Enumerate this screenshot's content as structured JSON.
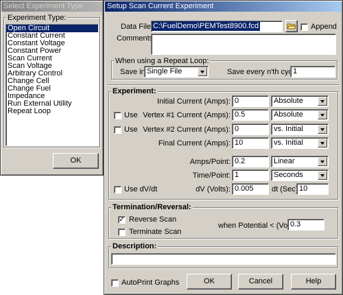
{
  "select_dialog": {
    "title": "Select Experiment Type",
    "group_label": "Experiment Type:",
    "items": [
      "Open Circuit",
      "Constant Current",
      "Constant Voltage",
      "Constant Power",
      "Scan Current",
      "Scan Voltage",
      "Arbitrary Control",
      "Change Cell",
      "Change Fuel",
      "Impedance",
      "Run External Utility",
      "Repeat Loop"
    ],
    "selected": "Open Circuit",
    "ok_label": "OK"
  },
  "setup_dialog": {
    "title": "Setup Scan Current Experiment",
    "data_file_label": "Data File:",
    "data_file_value": "C:\\FuelDemo\\PEMTest8900.fcd",
    "append_label": "Append",
    "comments_label": "Comments:",
    "comments_value": "",
    "repeat": {
      "title": "When using a Repeat Loop:",
      "save_in_label": "Save in:",
      "save_in_value": "Single File",
      "save_every_label": "Save every n'th cycle:",
      "save_every_value": "1"
    },
    "experiment": {
      "title": "Experiment:",
      "initial_label": "Initial Current (Amps):",
      "initial_value": "0",
      "initial_mode": "Absolute",
      "use1_label": "Use",
      "vertex1_label": "Vertex #1 Current (Amps):",
      "vertex1_value": "0.5",
      "vertex1_mode": "Absolute",
      "use2_label": "Use",
      "vertex2_label": "Vertex #2 Current (Amps):",
      "vertex2_value": "0",
      "vertex2_mode": "vs. Initial",
      "final_label": "Final Current (Amps):",
      "final_value": "10",
      "final_mode": "vs. Initial",
      "amps_point_label": "Amps/Point:",
      "amps_point_value": "0.2",
      "amps_point_mode": "Linear",
      "time_point_label": "Time/Point:",
      "time_point_value": "1",
      "time_point_unit": "Seconds",
      "use_dvdt_label": "Use dV/dt",
      "dv_label": "dV (Volts):",
      "dv_value": "0.005",
      "dt_label": "dt (Sec):",
      "dt_value": "10"
    },
    "termination": {
      "title": "Termination/Reversal:",
      "reverse_label": "Reverse Scan",
      "reverse_checked": "✓",
      "terminate_label": "Terminate Scan",
      "potential_label": "when Potential < (Volts):",
      "potential_value": "0.3"
    },
    "description": {
      "title": "Description:",
      "value": ""
    },
    "autoprint_label": "AutoPrint Graphs",
    "ok_label": "OK",
    "cancel_label": "Cancel",
    "help_label": "Help"
  }
}
